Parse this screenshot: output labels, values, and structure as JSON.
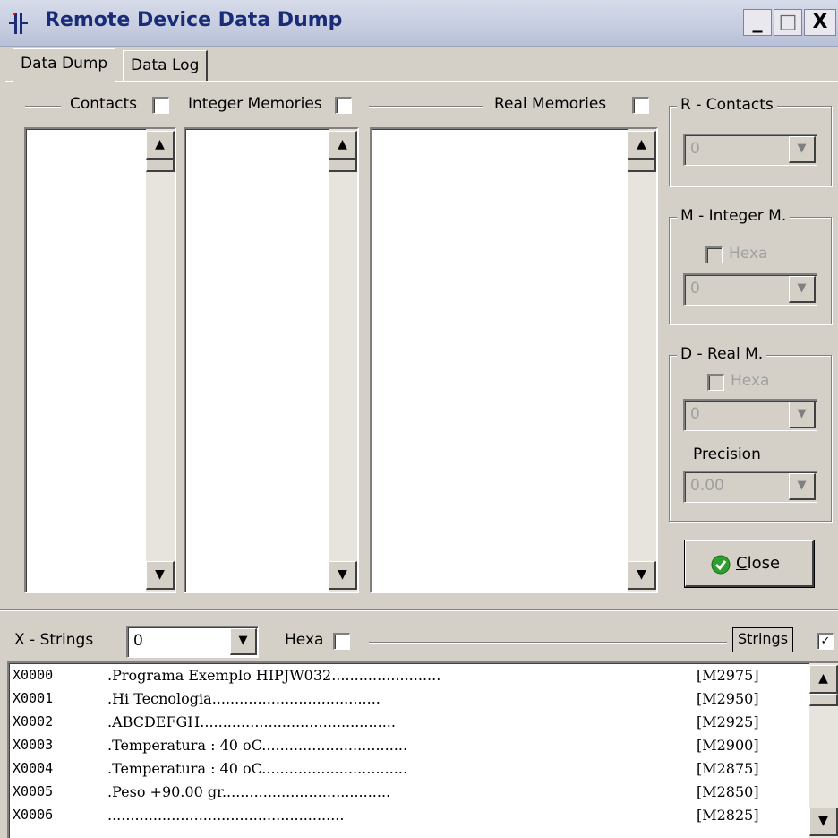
{
  "window": {
    "title": "Remote Device Data Dump",
    "controls": {
      "minimize": "_",
      "maximize": "□",
      "close": "X"
    }
  },
  "tabs": [
    {
      "label": "Data Dump",
      "active": true
    },
    {
      "label": "Data Log",
      "active": false
    }
  ],
  "lists": {
    "contacts": {
      "label": "Contacts",
      "checked": false
    },
    "integer_memories": {
      "label": "Integer Memories",
      "checked": false
    },
    "real_memories": {
      "label": "Real Memories",
      "checked": false
    }
  },
  "r_contacts": {
    "title": "R - Contacts",
    "value": "0"
  },
  "m_integer": {
    "title": "M - Integer M.",
    "hexa_label": "Hexa",
    "value": "0"
  },
  "d_real": {
    "title": "D - Real M.",
    "hexa_label": "Hexa",
    "value": "0",
    "precision_label": "Precision",
    "precision_value": "0.00"
  },
  "close_button": {
    "label": "Close",
    "icon": "green-check-icon"
  },
  "strings_bar": {
    "label": "X - Strings",
    "value": "0",
    "hexa_label": "Hexa",
    "hexa_checked": false,
    "strings_button": "Strings",
    "strings_checked": true
  },
  "strings": [
    {
      "addr": "X0000",
      "text": ".Programa Exemplo HIPJW032........................",
      "mem": "[M2975]"
    },
    {
      "addr": "X0001",
      "text": ".Hi Tecnologia.....................................",
      "mem": "[M2950]"
    },
    {
      "addr": "X0002",
      "text": ".ABCDEFGH...........................................",
      "mem": "[M2925]"
    },
    {
      "addr": "X0003",
      "text": ".Temperatura : 40 oC................................",
      "mem": "[M2900]"
    },
    {
      "addr": "X0004",
      "text": ".Temperatura : 40 oC................................",
      "mem": "[M2875]"
    },
    {
      "addr": "X0005",
      "text": ".Peso +90.00 gr.....................................",
      "mem": "[M2850]"
    },
    {
      "addr": "X0006",
      "text": "....................................................",
      "mem": "[M2825]"
    }
  ],
  "colors": {
    "title_text": "#1a2c78",
    "face": "#d4d0c8"
  }
}
